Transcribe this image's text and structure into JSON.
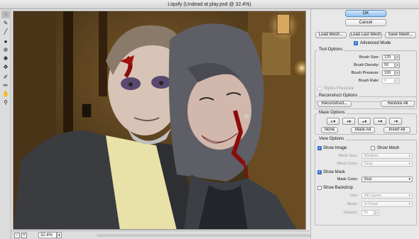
{
  "window": {
    "title": "Liquify (Undead at play.psd @ 32.4%)"
  },
  "tools": [
    "forward-warp",
    "reconstruct",
    "smooth",
    "twirl-clockwise",
    "pucker",
    "bloat",
    "push-left",
    "freeze-mask",
    "thaw-mask",
    "hand",
    "zoom"
  ],
  "status": {
    "zoom_value": "32.4%",
    "zoom_out": "−",
    "zoom_in": "+"
  },
  "panel": {
    "ok": "OK",
    "cancel": "Cancel",
    "load_mesh": "Load Mesh...",
    "load_last_mesh": "Load Last Mesh",
    "save_mesh": "Save Mesh...",
    "advanced_mode": "Advanced Mode",
    "tool_options": {
      "title": "Tool Options",
      "brush_size": {
        "label": "Brush Size:",
        "value": "125"
      },
      "brush_density": {
        "label": "Brush Density:",
        "value": "50"
      },
      "brush_pressure": {
        "label": "Brush Pressure:",
        "value": "100"
      },
      "brush_rate": {
        "label": "Brush Rate:",
        "value": "0"
      },
      "stylus_pressure": "Stylus Pressure"
    },
    "reconstruct_options": {
      "title": "Reconstruct Options",
      "reconstruct": "Reconstruct...",
      "restore_all": "Restore All"
    },
    "mask_options": {
      "title": "Mask Options",
      "none": "None",
      "mask_all": "Mask All",
      "invert_all": "Invert All"
    },
    "view_options": {
      "title": "View Options",
      "show_image": "Show Image",
      "show_mesh": "Show Mesh",
      "mesh_size": {
        "label": "Mesh Size:",
        "value": "Medium"
      },
      "mesh_color": {
        "label": "Mesh Color:",
        "value": "Gray"
      },
      "show_mask": "Show Mask",
      "mask_color": {
        "label": "Mask Color:",
        "value": "Red"
      },
      "show_backdrop": "Show Backdrop",
      "use": {
        "label": "Use:",
        "value": "All Layers"
      },
      "mode": {
        "label": "Mode:",
        "value": "In Front"
      },
      "opacity": {
        "label": "Opacity:",
        "value": "50"
      }
    }
  }
}
